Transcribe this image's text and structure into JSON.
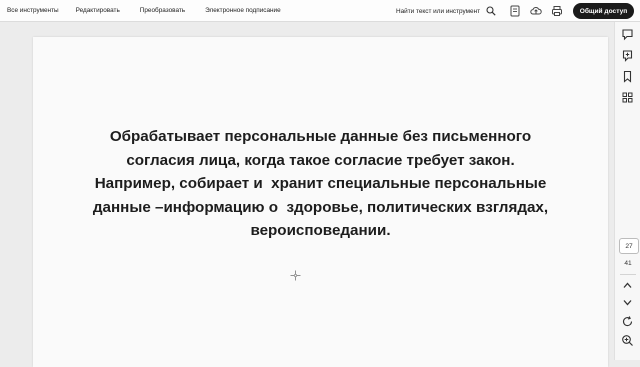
{
  "menu": {
    "items": [
      "Все инструменты",
      "Редактировать",
      "Преобразовать",
      "Электронное подписание"
    ]
  },
  "search": {
    "label": "Найти текст или инструмент"
  },
  "share_button": {
    "label": "Общий доступ"
  },
  "document": {
    "lines": [
      "Обрабатывает персональные данные без письменного",
      "согласия лица, когда такое согласие требует закон.",
      "Например, собирает и  хранит специальные персональные",
      "данные –информацию о  здоровье, политических взглядах,",
      "вероисповедании."
    ]
  },
  "pagination": {
    "current_page": "27",
    "total_pages": "41"
  },
  "icons": [
    "search-icon",
    "file-save-icon",
    "cloud-upload-icon",
    "print-icon",
    "chat-icon",
    "comment-icon",
    "bookmark-icon",
    "grid-icon",
    "chevron-up-icon",
    "chevron-down-icon",
    "refresh-icon",
    "zoom-icon"
  ]
}
